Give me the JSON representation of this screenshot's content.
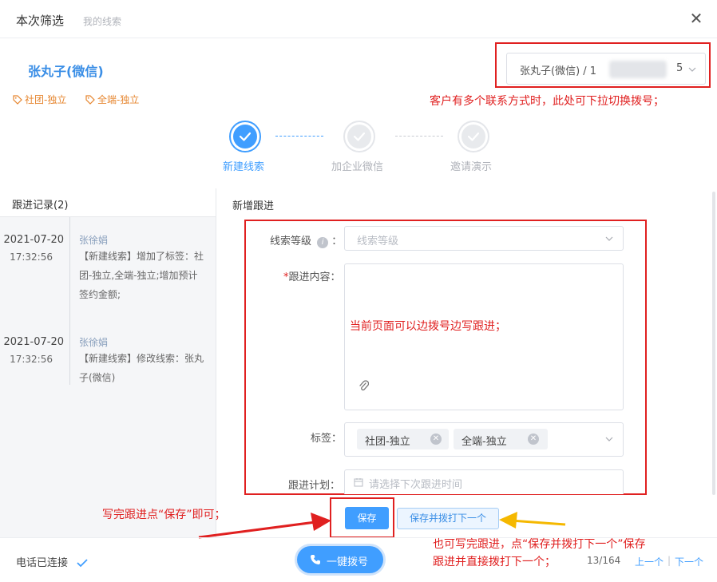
{
  "header": {
    "title": "本次筛选",
    "subtitle": "我的线索",
    "close": "✕"
  },
  "customer": {
    "name": "张丸子(微信)",
    "tags": [
      "社团-独立",
      "全端-独立"
    ],
    "phone_prefix": "张丸子(微信) / 1",
    "phone_suffix": "5"
  },
  "annotations": {
    "phone": "客户有多个联系方式时，此处可下拉切换拨号；",
    "content": "当前页面可以边拨号边写跟进；",
    "save": "写完跟进点“保存”即可；",
    "save_next_line1": "也可写完跟进，点“保存并拨打下一个”保存",
    "save_next_line2": "跟进并直接拨打下一个；"
  },
  "steps": [
    {
      "label": "新建线索",
      "active": true
    },
    {
      "label": "加企业微信",
      "active": false
    },
    {
      "label": "邀请演示",
      "active": false
    }
  ],
  "records": {
    "title": "跟进记录(2)",
    "items": [
      {
        "date": "2021-07-20",
        "time": "17:32:56",
        "author": "张徐娟",
        "lines": [
          "【新建线索】增加了标签：社",
          "团-独立,全端-独立;增加预计",
          "签约金额;"
        ]
      },
      {
        "date": "2021-07-20",
        "time": "17:32:56",
        "author": "张徐娟",
        "lines": [
          "【新建线索】修改线索：张丸",
          "子(微信)"
        ]
      }
    ]
  },
  "form": {
    "title": "新增跟进",
    "level_label": "线索等级",
    "level_colon": "：",
    "level_placeholder": "线索等级",
    "content_required": "*",
    "content_label": "跟进内容：",
    "tags_label": "标签：",
    "tags": [
      "社团-独立",
      "全端-独立"
    ],
    "plan_label": "跟进计划：",
    "plan_placeholder": "请选择下次跟进时间"
  },
  "buttons": {
    "save": "保存",
    "save_next": "保存并拨打下一个",
    "dial": "一键拨号"
  },
  "footer": {
    "connected": "电话已连接",
    "page": "13/164",
    "prev": "上一个",
    "separator": "|",
    "next": "下一个"
  },
  "colors": {
    "primary": "#409eff",
    "annotation": "#e02020",
    "tag": "#e6852e",
    "arrow_yellow": "#f5b800"
  }
}
